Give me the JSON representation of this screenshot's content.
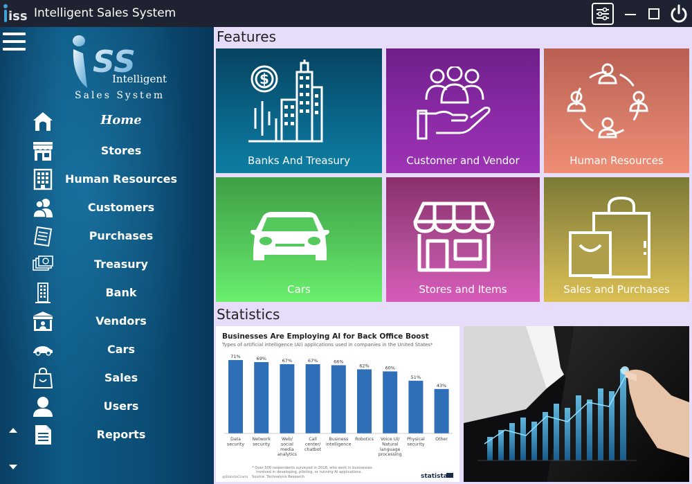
{
  "app": {
    "title": "Intelligent Sales System",
    "logo_text": "iss",
    "brand_line1": "Intelligent",
    "brand_line2": "Sales System"
  },
  "window_controls": [
    {
      "name": "settings",
      "icon": "sliders-icon"
    },
    {
      "name": "minimize",
      "icon": "minimize-icon"
    },
    {
      "name": "maximize",
      "icon": "maximize-icon"
    },
    {
      "name": "power",
      "icon": "power-icon"
    }
  ],
  "sidebar": {
    "items": [
      {
        "label": "Home",
        "icon": "home-icon"
      },
      {
        "label": "Stores",
        "icon": "store-icon"
      },
      {
        "label": "Human Resources",
        "icon": "building-icon"
      },
      {
        "label": "Customers",
        "icon": "users-icon"
      },
      {
        "label": "Purchases",
        "icon": "receipt-icon"
      },
      {
        "label": "Treasury",
        "icon": "money-icon"
      },
      {
        "label": "Bank",
        "icon": "tower-icon"
      },
      {
        "label": "Vendors",
        "icon": "vendor-stall-icon"
      },
      {
        "label": "Cars",
        "icon": "car-icon"
      },
      {
        "label": "Sales",
        "icon": "shopping-bag-icon"
      },
      {
        "label": "Users",
        "icon": "user-icon"
      },
      {
        "label": "Reports",
        "icon": "document-icon"
      }
    ]
  },
  "main": {
    "features_title": "Features",
    "statistics_title": "Statistics",
    "tiles": [
      {
        "label": "Banks And Treasury",
        "icon": "finance-buildings-icon",
        "color": "#0a6589"
      },
      {
        "label": "Customer and Vendor",
        "icon": "customer-hand-icon",
        "color": "#8b2aa6"
      },
      {
        "label": "Human Resources",
        "icon": "people-circle-icon",
        "color": "#d67b67"
      },
      {
        "label": "Cars",
        "icon": "car-front-icon",
        "color": "#54c85b"
      },
      {
        "label": "Stores and Items",
        "icon": "storefront-icon",
        "color": "#b04d96"
      },
      {
        "label": "Sales and Purchases",
        "icon": "shopping-bags-icon",
        "color": "#b09f4a"
      }
    ]
  },
  "chart_data": {
    "type": "bar",
    "title": "Businesses Are Employing AI for Back Office Boost",
    "subtitle": "Types of artificial intelligence (AI) applications used in companies in the United States*",
    "categories": [
      "Data security",
      "Network security",
      "Web/ social media analytics",
      "Call center/ chatbot",
      "Business intelligence",
      "Robotics",
      "Voice UI/ Natural language processing",
      "Physical security",
      "Other"
    ],
    "category_lines": [
      [
        "Data",
        "security"
      ],
      [
        "Network",
        "security"
      ],
      [
        "Web/",
        "social",
        "media",
        "analytics"
      ],
      [
        "Call",
        "center/",
        "chatbot"
      ],
      [
        "Business",
        "intelligence"
      ],
      [
        "Robotics"
      ],
      [
        "Voice UI/",
        "Natural",
        "language",
        "processing"
      ],
      [
        "Physical",
        "security"
      ],
      [
        "Other"
      ]
    ],
    "values": [
      71,
      69,
      67,
      67,
      66,
      62,
      60,
      51,
      43
    ],
    "value_labels": [
      "71%",
      "69%",
      "67%",
      "67%",
      "66%",
      "62%",
      "60%",
      "51%",
      "43%"
    ],
    "ylim": [
      0,
      75
    ],
    "bar_color": "#2f6fb7",
    "footnote_line1": "* Over 500 respondents surveyed in 2018, who work in businesses",
    "footnote_line2": "involved in developing, piloting, or running AI applications.",
    "source": "Source: Technalysis Research",
    "credit": "@StatistaCharts",
    "brand": "statista"
  }
}
